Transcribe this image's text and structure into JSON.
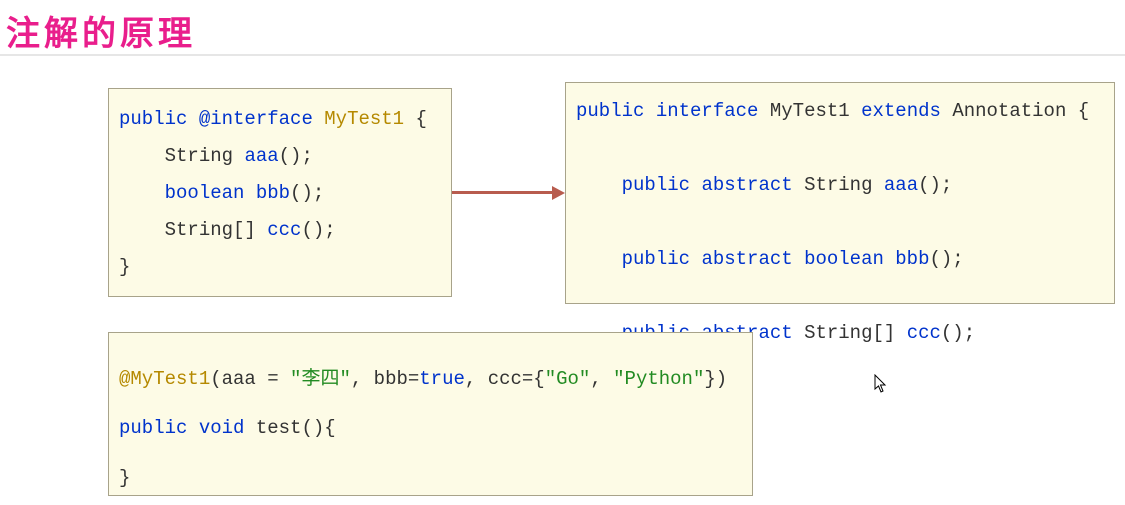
{
  "title": "注解的原理",
  "box1": {
    "l1": {
      "kw1": "public",
      "kw2": "@interface",
      "name": "MyTest1",
      "brace": " {"
    },
    "l2": {
      "t": "String ",
      "m": "aaa",
      "p": "();"
    },
    "l3": {
      "t": "boolean ",
      "m": "bbb",
      "p": "();"
    },
    "l4": {
      "t": "String[] ",
      "m": "ccc",
      "p": "();"
    },
    "l5": "}"
  },
  "box2": {
    "l1": {
      "kw1": "public",
      "kw2": "interface",
      "name": "MyTest1",
      "kw3": "extends",
      "cls": "Annotation",
      "brace": " {"
    },
    "l2": {
      "k1": "public",
      "k2": "abstract",
      "t": "String ",
      "m": "aaa",
      "p": "();"
    },
    "l3": {
      "k1": "public",
      "k2": "abstract",
      "t": "boolean ",
      "m": "bbb",
      "p": "();"
    },
    "l4": {
      "k1": "public",
      "k2": "abstract",
      "t": "String[] ",
      "m": "ccc",
      "p": "();"
    },
    "l5": "}"
  },
  "box3": {
    "l1": {
      "anno": "@MyTest1",
      "open": "(",
      "a1k": "aaa = ",
      "a1v": "\"李四\"",
      "c1": ", ",
      "a2k": "bbb=",
      "a2v": "true",
      "c2": ", ",
      "a3k": "ccc={",
      "a3v1": "\"Go\"",
      "c3": ", ",
      "a3v2": "\"Python\"",
      "close": "})"
    },
    "l2": {
      "kw1": "public",
      "kw2": "void",
      "m": "test",
      "p": "(){"
    },
    "l3": "}"
  }
}
